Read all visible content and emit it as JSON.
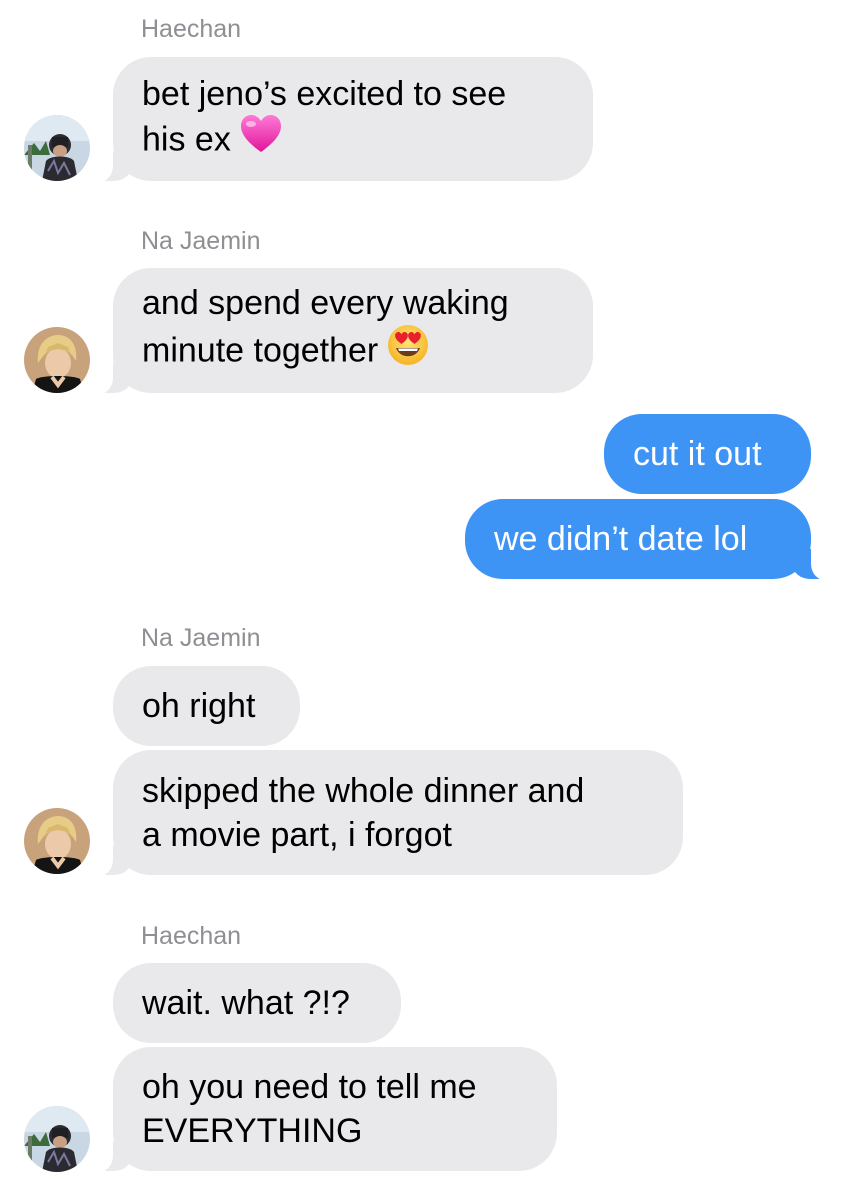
{
  "conversation": {
    "groups": [
      {
        "sender": "Haechan",
        "messages": [
          {
            "lines": [
              "bet jeno’s excited to see",
              "his ex"
            ],
            "emoji": "heart-icon"
          }
        ]
      },
      {
        "sender": "Na Jaemin",
        "messages": [
          {
            "lines": [
              "and spend every waking",
              "minute together"
            ],
            "emoji": "heart-eyes-icon"
          }
        ]
      },
      {
        "sender": "",
        "outgoing": true,
        "messages": [
          {
            "lines": [
              "cut it out"
            ]
          },
          {
            "lines": [
              "we didn’t date lol"
            ]
          }
        ]
      },
      {
        "sender": "Na Jaemin",
        "messages": [
          {
            "lines": [
              "oh right"
            ]
          },
          {
            "lines": [
              "skipped the whole dinner and",
              "a movie part, i forgot"
            ]
          }
        ]
      },
      {
        "sender": "Haechan",
        "messages": [
          {
            "lines": [
              "wait. what ?!?"
            ]
          },
          {
            "lines": [
              "oh you need to tell me",
              "EVERYTHING"
            ]
          }
        ]
      }
    ]
  },
  "colors": {
    "incoming_bubble": "#e9e9eb",
    "outgoing_bubble": "#3e94f5",
    "sender_name": "#8e8e93"
  },
  "avatars": {
    "haechan": "avatar-haechan",
    "jaemin": "avatar-jaemin"
  }
}
